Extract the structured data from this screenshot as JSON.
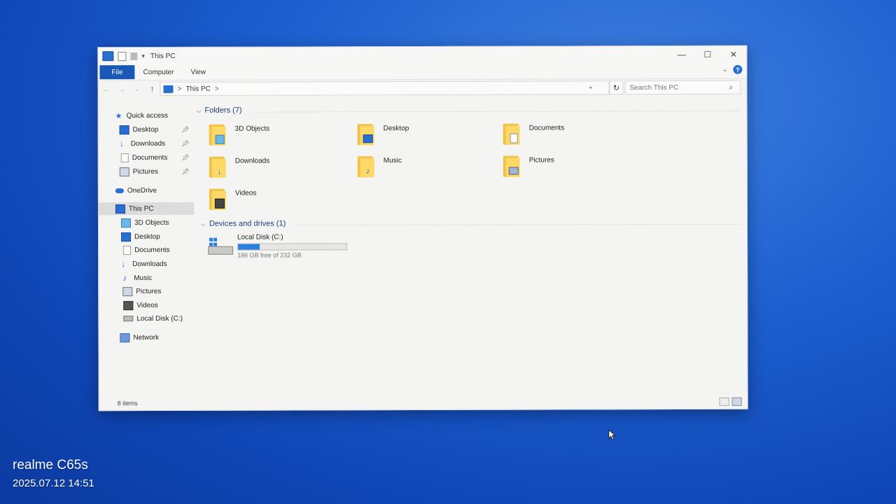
{
  "window": {
    "title": "This PC"
  },
  "ribbon": {
    "file": "File",
    "computer": "Computer",
    "view": "View",
    "help": "?"
  },
  "address": {
    "path": "This PC",
    "sep": ">",
    "search_placeholder": "Search This PC"
  },
  "nav": {
    "quick_access": "Quick access",
    "quick_items": [
      "Desktop",
      "Downloads",
      "Documents",
      "Pictures"
    ],
    "onedrive": "OneDrive",
    "this_pc": "This PC",
    "pc_items": [
      "3D Objects",
      "Desktop",
      "Documents",
      "Downloads",
      "Music",
      "Pictures",
      "Videos",
      "Local Disk (C:)"
    ],
    "network": "Network"
  },
  "folders": {
    "header": "Folders (7)",
    "items": [
      "3D Objects",
      "Desktop",
      "Documents",
      "Downloads",
      "Music",
      "Pictures",
      "Videos"
    ]
  },
  "devices": {
    "header": "Devices and drives (1)",
    "drive_name": "Local Disk (C:)",
    "drive_free": "186 GB free of 232 GB",
    "used_fraction": 0.198
  },
  "status": {
    "items": "8 items"
  },
  "watermark": {
    "device": "realme C65s",
    "datetime": "2025.07.12 14:51"
  }
}
